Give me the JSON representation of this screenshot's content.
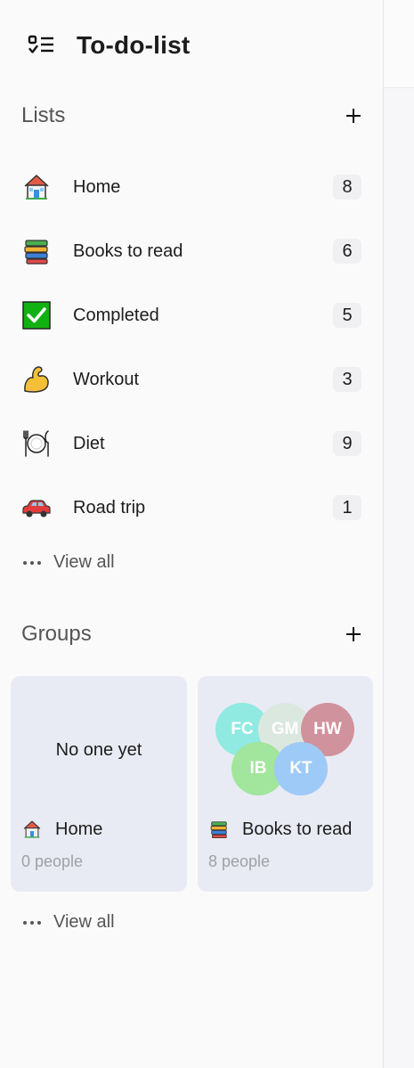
{
  "app": {
    "title": "To-do-list",
    "icon": "checklist-icon"
  },
  "lists_section": {
    "title": "Lists",
    "add_icon": "plus-icon",
    "items": [
      {
        "label": "Home",
        "count": "8",
        "icon": "house-emoji"
      },
      {
        "label": "Books to read",
        "count": "6",
        "icon": "books-emoji"
      },
      {
        "label": "Completed",
        "count": "5",
        "icon": "check-box-emoji"
      },
      {
        "label": "Workout",
        "count": "3",
        "icon": "flexed-biceps-emoji"
      },
      {
        "label": "Diet",
        "count": "9",
        "icon": "plate-cutlery-emoji"
      },
      {
        "label": "Road trip",
        "count": "1",
        "icon": "car-emoji"
      }
    ],
    "view_all": "View all"
  },
  "groups_section": {
    "title": "Groups",
    "add_icon": "plus-icon",
    "cards": [
      {
        "name": "Home",
        "people": "0 people",
        "empty_text": "No one yet",
        "icon": "house-emoji"
      },
      {
        "name": "Books to read",
        "people": "8 people",
        "icon": "books-emoji",
        "avatars": [
          {
            "initials": "FC",
            "color": "#90eae2"
          },
          {
            "initials": "GM",
            "color": "#dbe8e0"
          },
          {
            "initials": "HW",
            "color": "#d0929c"
          },
          {
            "initials": "IB",
            "color": "#a2e59c"
          },
          {
            "initials": "KT",
            "color": "#9ecaf8"
          }
        ]
      }
    ],
    "view_all": "View all"
  }
}
